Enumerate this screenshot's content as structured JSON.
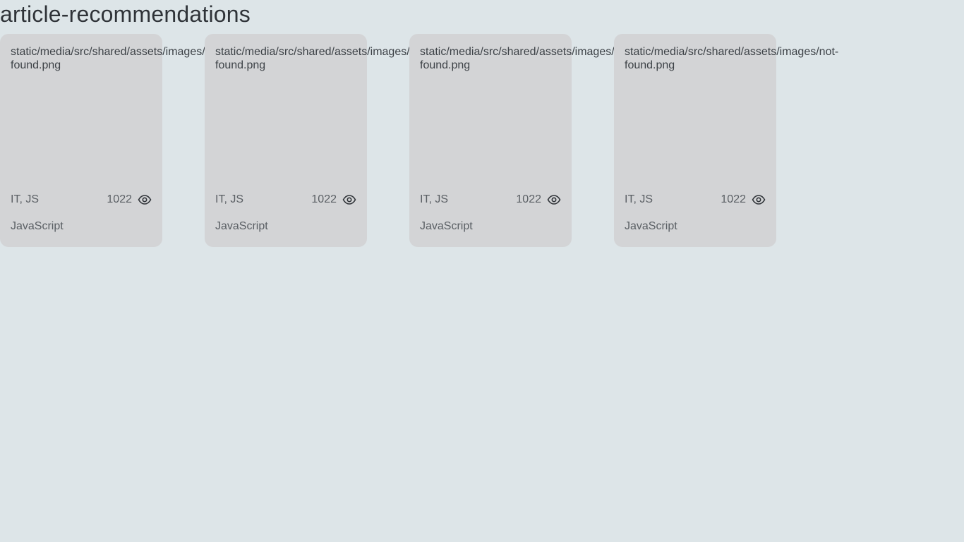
{
  "page": {
    "title": "article-recommendations"
  },
  "cards": [
    {
      "image_alt_line1": "static/media/src/shared/assets/images/not-",
      "image_alt_line2": "found.png",
      "types": "IT, JS",
      "views": "1022",
      "title": "JavaScript"
    },
    {
      "image_alt_line1": "static/media/src/shared/assets/images/not-",
      "image_alt_line2": "found.png",
      "types": "IT, JS",
      "views": "1022",
      "title": "JavaScript"
    },
    {
      "image_alt_line1": "static/media/src/shared/assets/images/not-",
      "image_alt_line2": "found.png",
      "types": "IT, JS",
      "views": "1022",
      "title": "JavaScript"
    },
    {
      "image_alt_line1": "static/media/src/shared/assets/images/not-",
      "image_alt_line2": "found.png",
      "types": "IT, JS",
      "views": "1022",
      "title": "JavaScript"
    }
  ],
  "icons": {
    "views": "eye-icon"
  },
  "colors": {
    "background": "#dde5e8",
    "card": "#d3d4d6"
  }
}
